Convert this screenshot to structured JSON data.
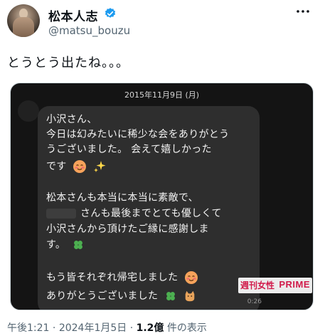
{
  "author": {
    "name": "松本人志",
    "handle": "@matsu_bouzu",
    "verified": true
  },
  "tweet": {
    "text": "とうとう出たね。。。"
  },
  "media": {
    "date_stamp": "2015年11月9日 (月)",
    "lines": [
      "小沢さん、",
      "今日は幻みたいに稀少な会をありがとう",
      "うございました。 会えて嬉しかった",
      "です",
      "松本さんも本当に本当に素敵で、",
      "さんも最後までとても優しくて",
      "小沢さんから頂けたご縁に感謝しま",
      "す。",
      "もう皆それぞれ帰宅しました",
      "ありがとうございました"
    ],
    "timer": "0:26",
    "watermark_mag": "週刊女性",
    "watermark_prime": "PRIME"
  },
  "meta": {
    "time": "午後1:21",
    "sep1": " · ",
    "date": "2024年1月5日",
    "sep2": " · ",
    "views": "1.2億",
    "views_suffix": " 件の表示"
  },
  "icons": {
    "verified": "verified-badge-icon",
    "more": "more-dots-icon",
    "emoji_smile": "smiling-face-icon",
    "emoji_sparkles": "sparkles-icon",
    "emoji_clover": "four-leaf-clover-icon",
    "emoji_cat": "cat-icon"
  },
  "colors": {
    "verified": "#1d9bf0",
    "text": "#0f1419",
    "secondary": "#536471",
    "watermark": "#d11a4a"
  }
}
